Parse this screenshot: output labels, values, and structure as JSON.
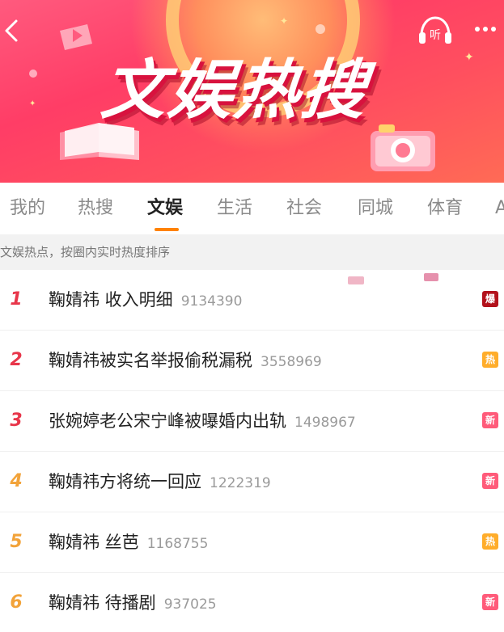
{
  "banner": {
    "title": "文娱热搜",
    "listen_label": "听"
  },
  "tabs": [
    {
      "label": "我的"
    },
    {
      "label": "热搜"
    },
    {
      "label": "文娱"
    },
    {
      "label": "生活"
    },
    {
      "label": "社会"
    },
    {
      "label": "同城"
    },
    {
      "label": "体育"
    },
    {
      "label": "A"
    }
  ],
  "active_tab": "文娱",
  "subtitle": "文娱热点，按圈内实时热度排序",
  "items": [
    {
      "rank": "1",
      "topic": "鞠婧祎 收入明细",
      "heat": "9134390",
      "badge": "爆",
      "rank_color": "#e8364a",
      "badge_color": "#b3121c"
    },
    {
      "rank": "2",
      "topic": "鞠婧祎被实名举报偷税漏税",
      "heat": "3558969",
      "badge": "热",
      "rank_color": "#e8364a",
      "badge_color": "#ffad2b"
    },
    {
      "rank": "3",
      "topic": "张婉婷老公宋宁峰被曝婚内出轨",
      "heat": "1498967",
      "badge": "新",
      "rank_color": "#e8364a",
      "badge_color": "#ff5b7a"
    },
    {
      "rank": "4",
      "topic": "鞠婧祎方将统一回应",
      "heat": "1222319",
      "badge": "新",
      "rank_color": "#f2a33a",
      "badge_color": "#ff5b7a"
    },
    {
      "rank": "5",
      "topic": "鞠婧祎 丝芭",
      "heat": "1168755",
      "badge": "热",
      "rank_color": "#f2a33a",
      "badge_color": "#ffad2b"
    },
    {
      "rank": "6",
      "topic": "鞠婧祎 待播剧",
      "heat": "937025",
      "badge": "新",
      "rank_color": "#f2a33a",
      "badge_color": "#ff5b7a"
    }
  ],
  "icons": {
    "back": "chevron-left-icon",
    "listen": "headphones-icon",
    "more": "more-dots-icon"
  },
  "colors": {
    "banner": "#ff3d66",
    "tab_underline": "#ff8200",
    "subtitle_bg": "#f2f2f2"
  }
}
